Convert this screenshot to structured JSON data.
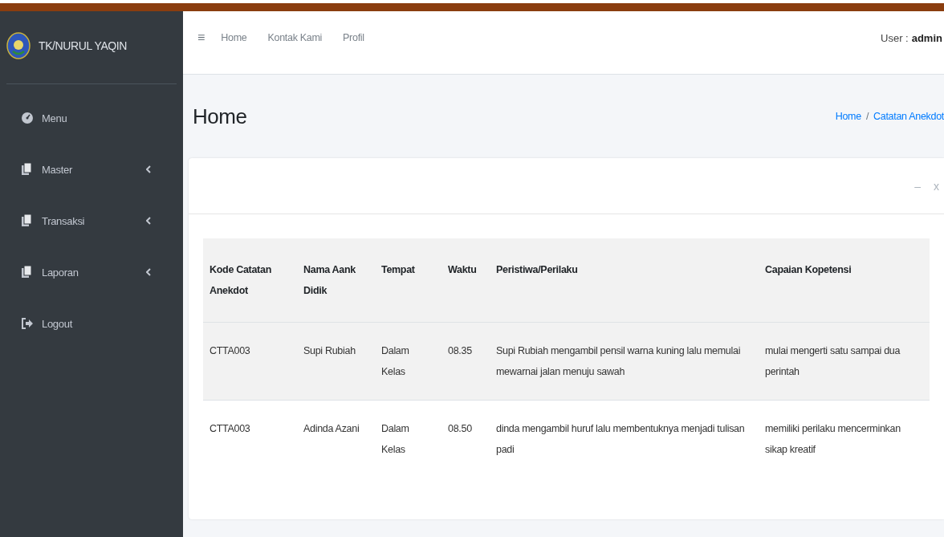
{
  "brand": {
    "title": "TK/NURUL YAQIN"
  },
  "sidebar": {
    "items": [
      {
        "label": "Menu",
        "kind": "dashboard",
        "expandable": false
      },
      {
        "label": "Master",
        "kind": "pages",
        "expandable": true
      },
      {
        "label": "Transaksi",
        "kind": "pages",
        "expandable": true
      },
      {
        "label": "Laporan",
        "kind": "pages",
        "expandable": true
      },
      {
        "label": "Logout",
        "kind": "logout",
        "expandable": false
      }
    ]
  },
  "navbar": {
    "menu_icon": "≡",
    "links": [
      "Home",
      "Kontak Kami",
      "Profil"
    ],
    "user_label": "User :",
    "user_name": "admin"
  },
  "page": {
    "title": "Home",
    "breadcrumb": [
      "Home",
      "Catatan Anekdot"
    ],
    "breadcrumb_separator": "/"
  },
  "card": {
    "tools": [
      "–",
      "x"
    ],
    "table": {
      "columns": [
        "Kode Catatan Anekdot",
        "Nama Aank Didik",
        "Tempat",
        "Waktu",
        "Peristiwa/Perilaku",
        "Capaian Kopetensi"
      ],
      "rows": [
        [
          "CTTA003",
          "Supi Rubiah",
          "Dalam Kelas",
          "08.35",
          "Supi Rubiah mengambil pensil warna kuning lalu memulai mewarnai jalan menuju sawah",
          "mulai mengerti satu sampai dua perintah"
        ],
        [
          "CTTA003",
          "Adinda Azani",
          "Dalam Kelas",
          "08.50",
          "dinda mengambil huruf lalu membentuknya menjadi tulisan padi",
          "memiliki perilaku mencerminkan sikap kreatif"
        ]
      ]
    }
  }
}
